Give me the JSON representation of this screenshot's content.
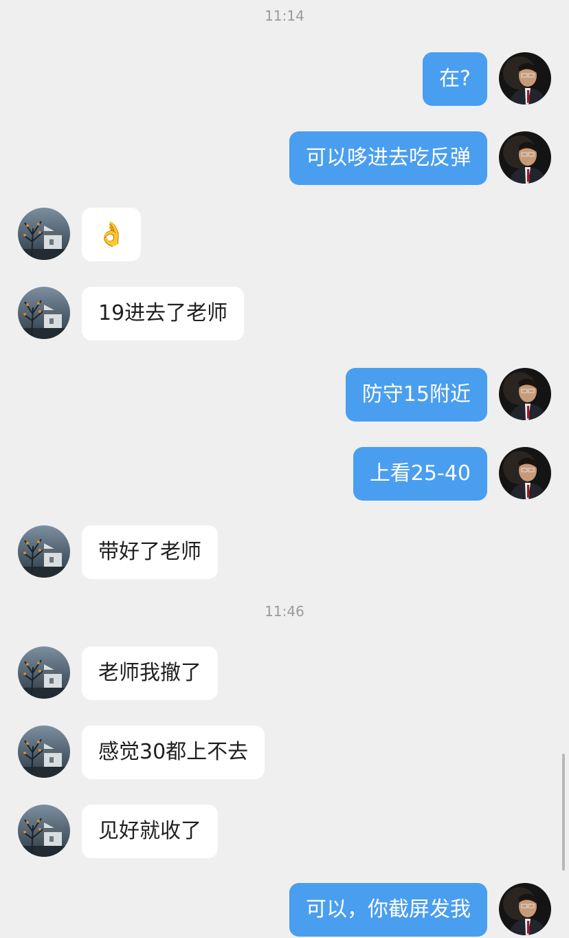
{
  "chat": {
    "timestamps": [
      "11:14",
      "11:46"
    ],
    "messages": [
      {
        "side": "right",
        "text": "在?",
        "avatar": "avatar-user-man-suit"
      },
      {
        "side": "right",
        "text": "可以哆进去吃反弹",
        "avatar": "avatar-user-man-suit"
      },
      {
        "side": "left",
        "text": "👌",
        "avatar": "avatar-contact-house-tree"
      },
      {
        "side": "left",
        "text": "19进去了老师",
        "avatar": "avatar-contact-house-tree"
      },
      {
        "side": "right",
        "text": "防守15附近",
        "avatar": "avatar-user-man-suit"
      },
      {
        "side": "right",
        "text": "上看25-40",
        "avatar": "avatar-user-man-suit"
      },
      {
        "side": "left",
        "text": "带好了老师",
        "avatar": "avatar-contact-house-tree"
      },
      {
        "side": "left",
        "text": "老师我撤了",
        "avatar": "avatar-contact-house-tree"
      },
      {
        "side": "left",
        "text": "感觉30都上不去",
        "avatar": "avatar-contact-house-tree"
      },
      {
        "side": "left",
        "text": "见好就收了",
        "avatar": "avatar-contact-house-tree"
      },
      {
        "side": "right",
        "text": "可以，你截屏发我",
        "avatar": "avatar-user-man-suit"
      }
    ]
  },
  "colors": {
    "background": "#efefef",
    "outgoing_bubble": "#4a9eef",
    "incoming_bubble": "#ffffff",
    "timestamp_text": "#9a9a9a"
  }
}
